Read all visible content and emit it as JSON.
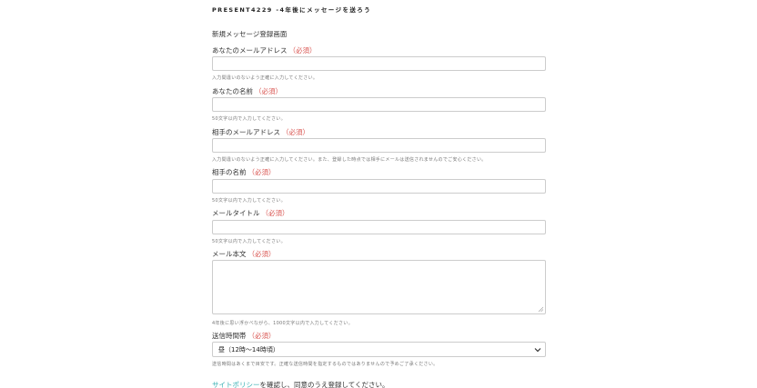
{
  "site_title": "PRESENT4229 -4年後にメッセージを送ろう",
  "form_heading": "新規メッセージ登録画面",
  "required_mark": "（必須）",
  "fields": {
    "your_email": {
      "label": "あなたのメールアドレス",
      "value": "",
      "help": "入力間違いのないよう正確に入力してください。"
    },
    "your_name": {
      "label": "あなたの名前",
      "value": "",
      "help": "50文字以内で入力してください。"
    },
    "recipient_email": {
      "label": "相手のメールアドレス",
      "value": "",
      "help": "入力間違いのないよう正確に入力してください。また、登録した時点では相手にメールは送信されませんのでご安心ください。"
    },
    "recipient_name": {
      "label": "相手の名前",
      "value": "",
      "help": "50文字以内で入力してください。"
    },
    "mail_title": {
      "label": "メールタイトル",
      "value": "",
      "help": "50文字以内で入力してください。"
    },
    "mail_body": {
      "label": "メール本文",
      "value": "",
      "help": "4年後に思い浮かべながら、1000文字以内で入力してください。"
    },
    "send_time": {
      "label": "送信時間帯",
      "selected": "昼（12時〜14時頃）",
      "help": "送信時間はあくまで目安です。正確な送信時間を指定するものではありませんので予めご了承ください。"
    }
  },
  "consent": {
    "link_text": "サイトポリシー",
    "text": "を確認し、同意のうえ登録してください。"
  },
  "colors": {
    "required": "#d9534f",
    "link": "#3ab0b4",
    "border": "#cccccc"
  }
}
